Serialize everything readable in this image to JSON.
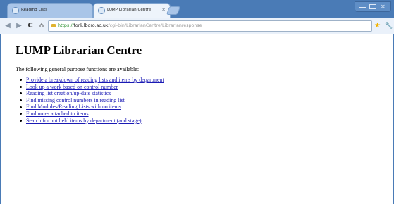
{
  "browser": {
    "tabs": [
      {
        "label": "Reading Lists",
        "active": false
      },
      {
        "label": "LUMP Librarian Centre",
        "active": true
      }
    ],
    "address": {
      "scheme": "https://",
      "host": "forli.lboro.ac.uk",
      "path": "/cgi-bin/LibrarianCentre/Librarianresponse"
    },
    "icons": {
      "back": "back-arrow-icon",
      "forward": "forward-arrow-icon",
      "reload": "reload-icon",
      "home": "home-icon",
      "secure": "lock-icon",
      "bookmark": "star-icon",
      "menu": "wrench-icon"
    },
    "accent_color": "#4a7bb6"
  },
  "page": {
    "title": "LUMP Librarian Centre",
    "intro": "The following general purpose functions are available:",
    "functions": [
      "Provide a breakdown of reading lists and items by department",
      "Look up a work based on control number",
      "Reading list creation/up-date statistics",
      "Find missing control numbers in reading list",
      "Find Modules/Reading Lists with no items",
      "Find notes attached to items",
      "Search for not held items by department (and stage)"
    ],
    "link_color": "#1a1ab4"
  }
}
